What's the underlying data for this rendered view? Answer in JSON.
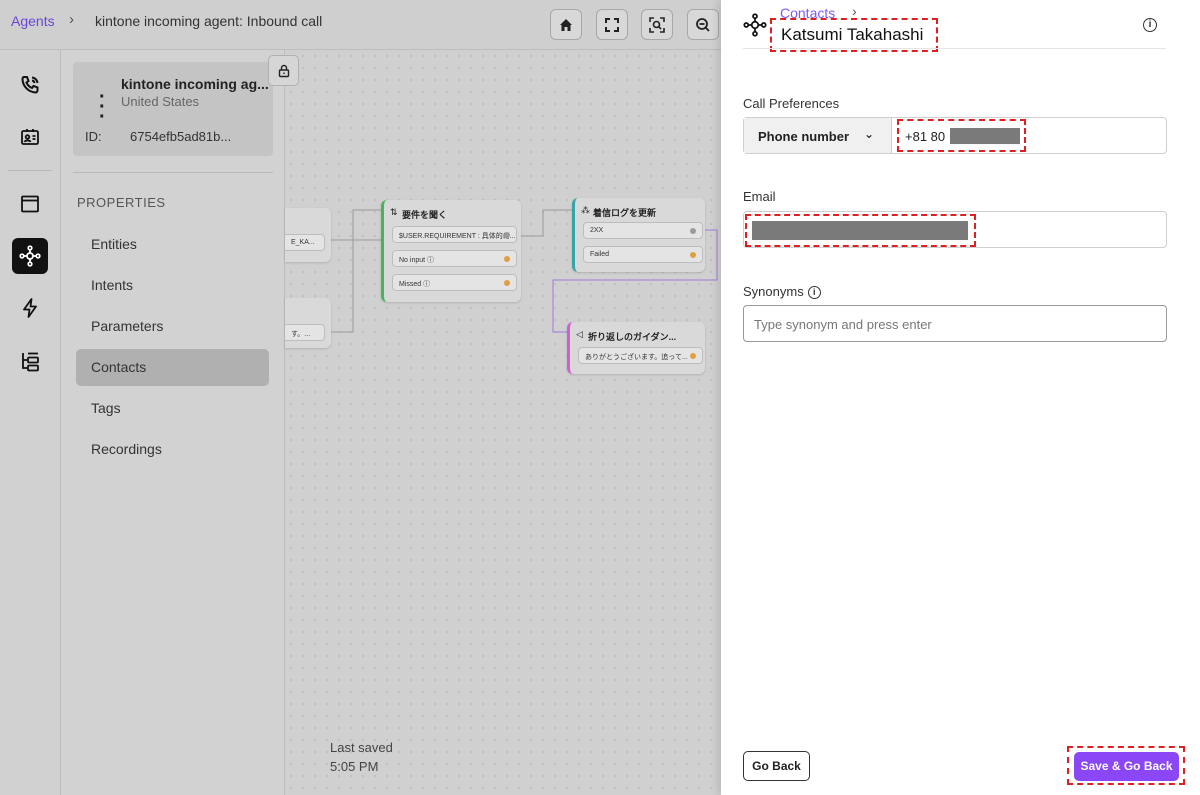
{
  "topbar": {
    "breadcrumb_root": "Agents",
    "breadcrumb_sep": "›",
    "title": "kintone incoming agent: Inbound call"
  },
  "agent": {
    "name": "kintone incoming ag...",
    "country": "United States",
    "id_label": "ID:",
    "id_value": "6754efb5ad81b..."
  },
  "properties": {
    "heading": "PROPERTIES",
    "items": [
      "Entities",
      "Intents",
      "Parameters",
      "Contacts",
      "Tags",
      "Recordings"
    ],
    "active": "Contacts"
  },
  "canvas": {
    "node_ask": {
      "title": "要件を聞く",
      "rows": [
        "$USER.REQUIREMENT : 具体的に...",
        "No input",
        "Missed"
      ]
    },
    "node_log": {
      "title": "着信ログを更新",
      "rows": [
        "2XX",
        "Failed"
      ]
    },
    "node_guide": {
      "title": "折り返しのガイダン...",
      "rows": [
        "ありがとうございます。追って..."
      ]
    },
    "partial_row_1": "E_KA...",
    "partial_row_2": "す。..."
  },
  "status": {
    "last_saved_label": "Last saved",
    "last_saved_time": "5:05 PM"
  },
  "drawer": {
    "breadcrumb": "Contacts",
    "breadcrumb_sep": "›",
    "title": "Katsumi Takahashi",
    "call_prefs_label": "Call Preferences",
    "phone_type": "Phone number",
    "phone_value": "+81 80",
    "email_label": "Email",
    "synonyms_label": "Synonyms",
    "synonyms_placeholder": "Type synonym and press enter",
    "go_back": "Go Back",
    "save": "Save & Go Back"
  },
  "colors": {
    "accent": "#8b46f5",
    "link": "#7c5cf0",
    "highlight": "#e02020"
  }
}
